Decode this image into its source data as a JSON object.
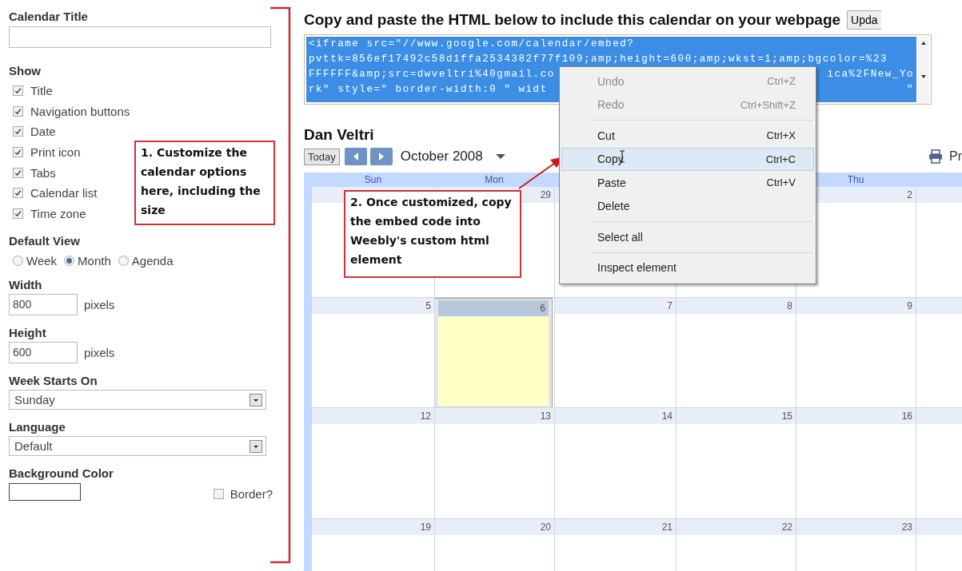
{
  "settings": {
    "title_field": {
      "label": "Calendar Title"
    },
    "show": {
      "label": "Show",
      "options": [
        {
          "label": "Title",
          "checked": true
        },
        {
          "label": "Navigation buttons",
          "checked": true
        },
        {
          "label": "Date",
          "checked": true
        },
        {
          "label": "Print icon",
          "checked": true
        },
        {
          "label": "Tabs",
          "checked": true
        },
        {
          "label": "Calendar list",
          "checked": true
        },
        {
          "label": "Time zone",
          "checked": true
        }
      ]
    },
    "default_view": {
      "label": "Default View",
      "options": [
        {
          "label": "Week",
          "selected": false
        },
        {
          "label": "Month",
          "selected": true
        },
        {
          "label": "Agenda",
          "selected": false
        }
      ]
    },
    "width": {
      "label": "Width",
      "value": "800",
      "unit": "pixels"
    },
    "height": {
      "label": "Height",
      "value": "600",
      "unit": "pixels"
    },
    "week_starts_on": {
      "label": "Week Starts On",
      "value": "Sunday"
    },
    "language": {
      "label": "Language",
      "value": "Default"
    },
    "background_color": {
      "label": "Background Color"
    },
    "border": {
      "label": "Border?",
      "checked": false
    }
  },
  "embed": {
    "heading": "Copy and paste the HTML below to include this calendar on your webpage",
    "update_button": "Upda",
    "code_lines": [
      {
        "text": "<iframe src=\"//www.google.com/calendar/embed?"
      },
      {
        "text": "pvttk=856ef17492c58d1ffa2534382f77f109;amp;height=600;amp;wkst=1;amp;bgcolor=%23"
      },
      {
        "text": "FFFFFF&amp;src=dwveltri%40gmail.co",
        "text_after": "ica%2FNew_Yo"
      },
      {
        "text": "rk\" style=\" border-width:0 \" widt",
        "text_after": "\""
      }
    ]
  },
  "calendar": {
    "title": "Dan Veltri",
    "today_button": "Today",
    "month": "October 2008",
    "print_label": "Pr",
    "weekdays": {
      "sun": "Sun",
      "mon": "Mon",
      "thu": "Thu"
    },
    "weeks": [
      {
        "days": {
          "mon": {
            "number": "29",
            "today": false
          },
          "thu": {
            "number": "2",
            "today": false
          }
        }
      },
      {
        "days": {
          "sun": {
            "number": "5",
            "today": false
          },
          "mon": {
            "number": "6",
            "today": true
          },
          "tue": {
            "number": "7",
            "today": false
          },
          "wed": {
            "number": "8",
            "today": false
          },
          "thu": {
            "number": "9",
            "today": false
          }
        }
      },
      {
        "days": {
          "sun": {
            "number": "12",
            "today": false
          },
          "mon": {
            "number": "13",
            "today": false
          },
          "tue": {
            "number": "14",
            "today": false
          },
          "wed": {
            "number": "15",
            "today": false
          },
          "thu": {
            "number": "16",
            "today": false
          }
        }
      },
      {
        "days": {
          "sun": {
            "number": "19",
            "today": false
          },
          "mon": {
            "number": "20",
            "today": false
          },
          "tue": {
            "number": "21",
            "today": false
          },
          "wed": {
            "number": "22",
            "today": false
          },
          "thu": {
            "number": "23",
            "today": false
          }
        }
      }
    ]
  },
  "context_menu": {
    "groups": [
      {
        "items": [
          {
            "label": "Undo",
            "shortcut": "Ctrl+Z",
            "disabled": true,
            "selected": false
          },
          {
            "label": "Redo",
            "shortcut": "Ctrl+Shift+Z",
            "disabled": true,
            "selected": false
          }
        ]
      },
      {
        "items": [
          {
            "label": "Cut",
            "shortcut": "Ctrl+X",
            "disabled": false,
            "selected": false
          },
          {
            "label": "Copy",
            "shortcut": "Ctrl+C",
            "disabled": false,
            "selected": true
          },
          {
            "label": "Paste",
            "shortcut": "Ctrl+V",
            "disabled": false,
            "selected": false
          },
          {
            "label": "Delete",
            "disabled": false,
            "selected": false
          }
        ]
      },
      {
        "items": [
          {
            "label": "Select all",
            "disabled": false,
            "selected": false
          }
        ]
      },
      {
        "items": [
          {
            "label": "Inspect element",
            "disabled": false,
            "selected": false
          }
        ]
      }
    ]
  },
  "callouts": [
    {
      "text": "1. Customize the calendar options here, including the size"
    },
    {
      "text": "2. Once customized, copy the embed code into Weebly's custom html element"
    }
  ]
}
